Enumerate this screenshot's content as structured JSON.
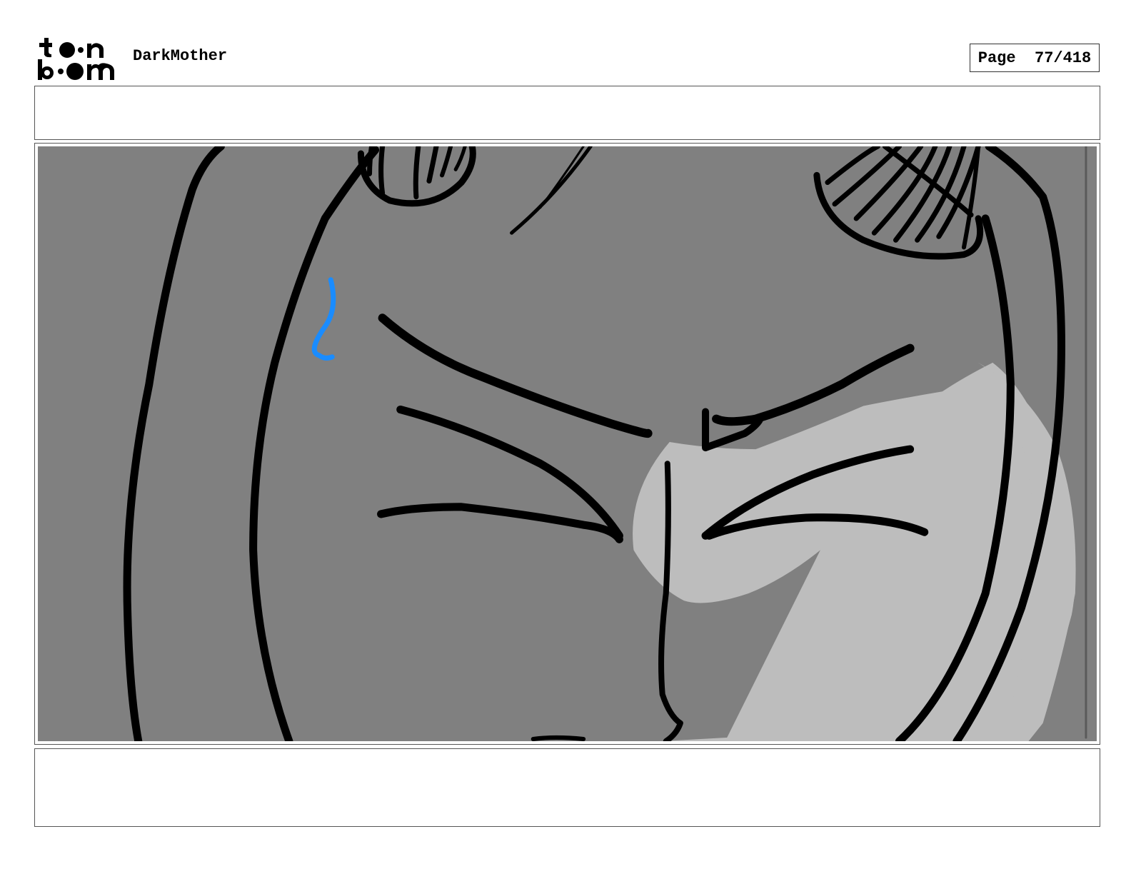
{
  "header": {
    "logo_icon": "toon-boom-logo",
    "project_title": "DarkMother",
    "page_label": "Page",
    "page_value": "77/418"
  },
  "panel": {
    "image_description_icon": "storyboard-sketch-closeup-face",
    "colors": {
      "background_gray": "#808080",
      "light_gray": "#bdbdbd",
      "ink": "#000000",
      "sweat_drop_blue": "#1a8cff"
    }
  },
  "notes_top": {
    "text": ""
  },
  "notes_bottom": {
    "text": ""
  }
}
